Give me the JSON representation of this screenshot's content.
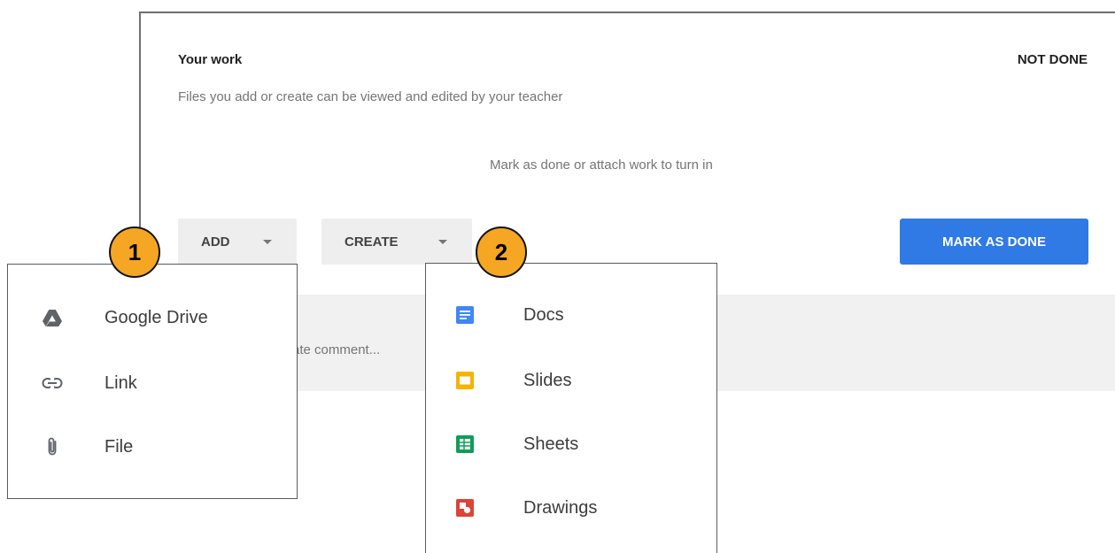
{
  "card": {
    "title": "Your work",
    "status": "NOT DONE",
    "subtitle": "Files you add or create can be viewed and edited by your teacher",
    "hint": "Mark as done or attach work to turn in",
    "add_label": "ADD",
    "create_label": "CREATE",
    "mark_done_label": "MARK AS DONE",
    "comment_placeholder": "ate comment..."
  },
  "add_menu": {
    "items": [
      {
        "label": "Google Drive",
        "icon": "google-drive-icon"
      },
      {
        "label": "Link",
        "icon": "link-icon"
      },
      {
        "label": "File",
        "icon": "paperclip-icon"
      }
    ]
  },
  "create_menu": {
    "items": [
      {
        "label": "Docs",
        "icon": "docs-icon",
        "color": "#4285f4"
      },
      {
        "label": "Slides",
        "icon": "slides-icon",
        "color": "#f4b400"
      },
      {
        "label": "Sheets",
        "icon": "sheets-icon",
        "color": "#0f9d58"
      },
      {
        "label": "Drawings",
        "icon": "drawings-icon",
        "color": "#db4437"
      }
    ]
  },
  "badges": {
    "one": "1",
    "two": "2"
  },
  "colors": {
    "primary_button": "#2f7ae5",
    "badge": "#f5a623"
  }
}
